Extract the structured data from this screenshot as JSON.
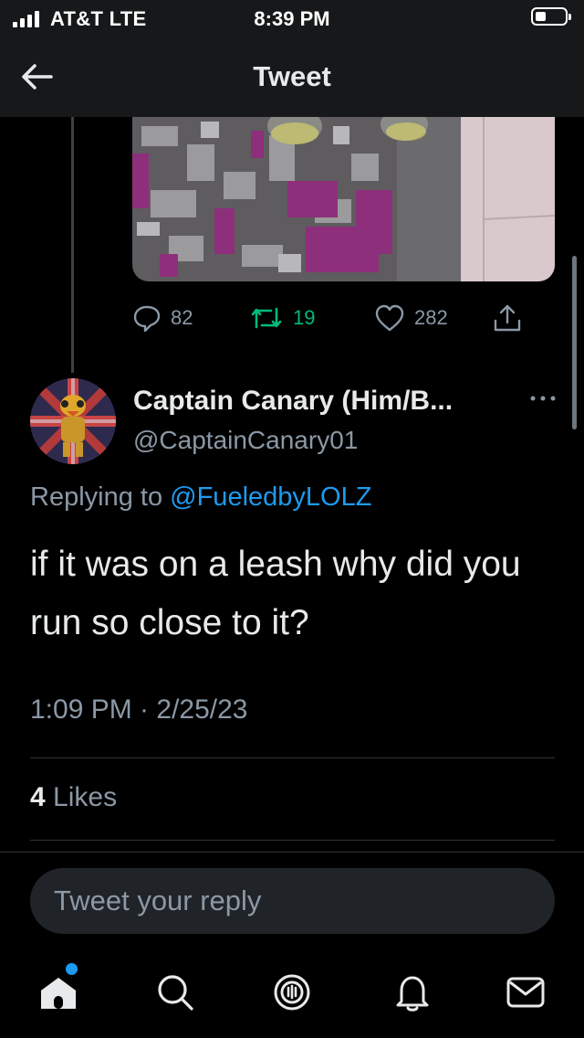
{
  "status": {
    "carrier": "AT&T  LTE",
    "time": "8:39 PM"
  },
  "nav": {
    "title": "Tweet",
    "back_icon": "arrow-left-icon"
  },
  "parent_tweet": {
    "image_icon": "photo-of-carpet-and-shoes",
    "actions": {
      "replies": "82",
      "retweets": "19",
      "likes": "282"
    },
    "colors": {
      "retweet": "#00ba7c",
      "muted": "#8b98a5"
    }
  },
  "tweet": {
    "author_name": "Captain Canary (Him/B...",
    "author_handle": "@CaptainCanary01",
    "replying_prefix": "Replying to",
    "replying_to": "@FueledbyLOLZ",
    "text": "if it was on a leash why did you run so close to it?",
    "timestamp": "1:09 PM · 2/25/23",
    "likes_count": "4",
    "likes_label": "Likes"
  },
  "reply": {
    "placeholder": "Tweet your reply"
  },
  "tabbar": {
    "items": [
      "home-icon",
      "search-icon",
      "spaces-icon",
      "notifications-icon",
      "messages-icon"
    ]
  },
  "theme": {
    "background": "#000000",
    "accent": "#1d9bf0",
    "text": "#e7e9ea",
    "muted": "#8b98a5"
  }
}
